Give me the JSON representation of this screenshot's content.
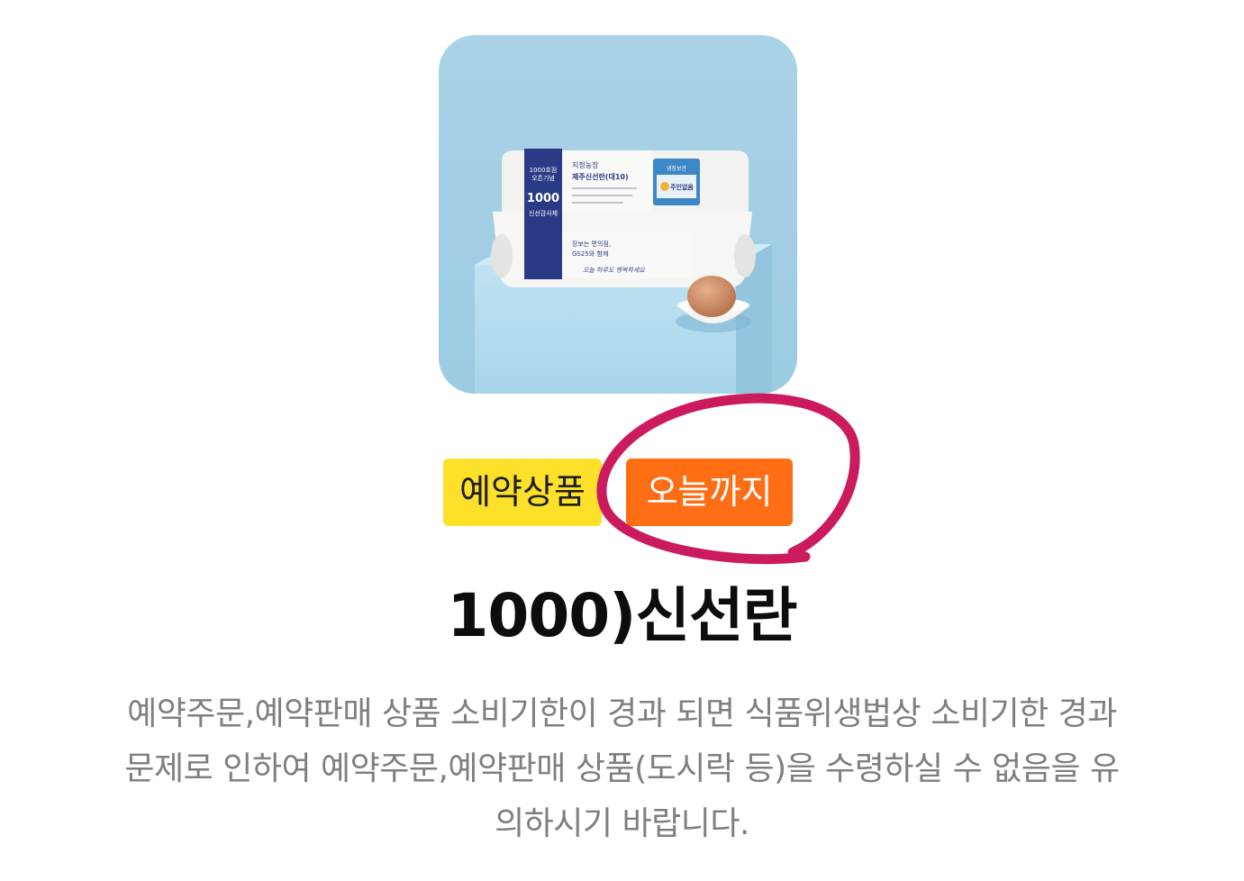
{
  "product": {
    "image_alt": "egg carton product photo",
    "package": {
      "side_line1": "1000호점",
      "side_line2": "오픈기념",
      "side_number": "1000",
      "side_label": "신선감사제",
      "front_farm": "지정농장",
      "front_name": "제주신선란(대10)",
      "front_box_title": "냉장보관",
      "front_box_text": "주인없음",
      "lower_text1": "장보는 편의점,",
      "lower_text2": "GS25와 함께",
      "lower_script": "오늘 하루도 행복하세요"
    },
    "badges": {
      "reserve": "예약상품",
      "today": "오늘까지"
    },
    "title": "1000)신선란",
    "notice": [
      "예약주문,예약판매 상품 소비기한이 경과 되면 식품위생법상 소비기한 경과",
      "문제로 인하여 예약주문,예약판매 상품(도시락 등)을 수령하실 수 없음을 유",
      "의하시기 바랍니다."
    ]
  },
  "colors": {
    "badge_reserve_bg": "#fde02a",
    "badge_today_bg": "#ff6d14",
    "annotation_circle": "#cc1a5e",
    "notice_text": "#7f7f7f"
  }
}
